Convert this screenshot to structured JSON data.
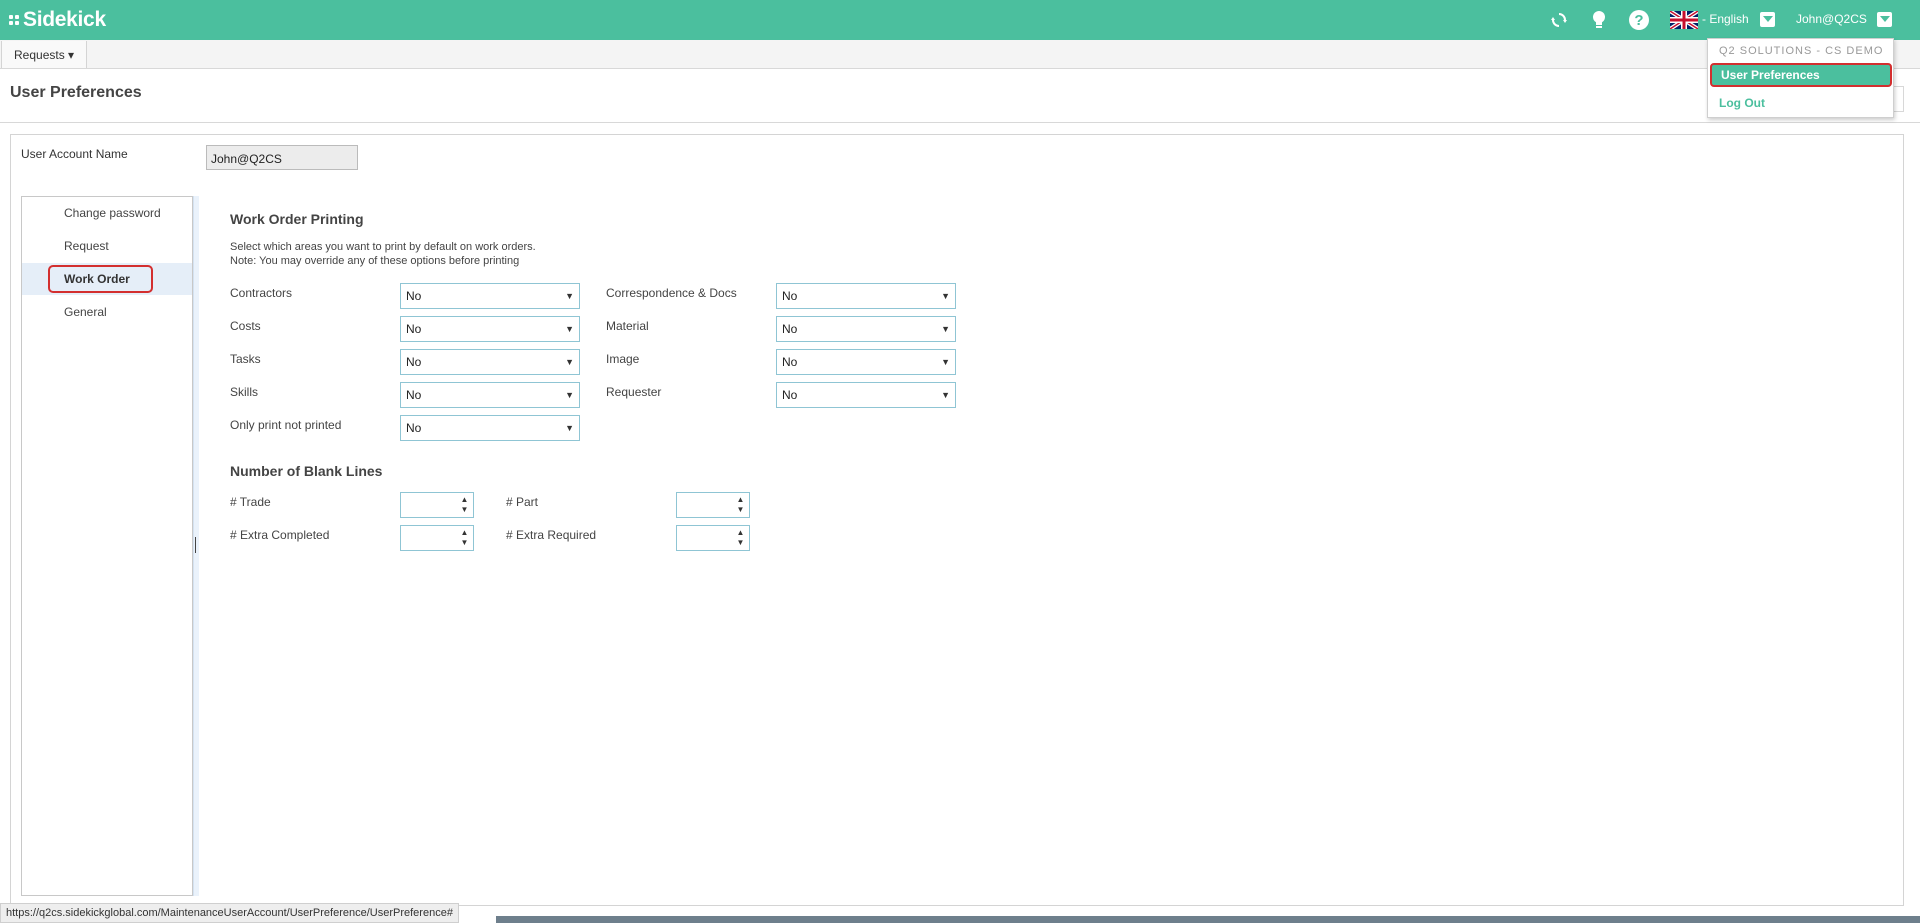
{
  "app": {
    "name": "Sidekick"
  },
  "topbar": {
    "language_label": "- English",
    "user_label": "John@Q2CS"
  },
  "subnav": {
    "requests_label": "Requests ▾"
  },
  "page": {
    "title": "User Preferences"
  },
  "account": {
    "label": "User Account Name",
    "value": "John@Q2CS"
  },
  "sidenav": {
    "items": [
      {
        "label": "Change password"
      },
      {
        "label": "Request"
      },
      {
        "label": "Work Order"
      },
      {
        "label": "General"
      }
    ],
    "active_index": 2
  },
  "printing": {
    "heading": "Work Order Printing",
    "desc_line1": "Select which areas you want to print by default on work orders.",
    "desc_line2": "Note: You may override any of these options before printing",
    "fields": [
      {
        "label": "Contractors",
        "value": "No"
      },
      {
        "label": "Correspondence & Docs",
        "value": "No"
      },
      {
        "label": "Costs",
        "value": "No"
      },
      {
        "label": "Material",
        "value": "No"
      },
      {
        "label": "Tasks",
        "value": "No"
      },
      {
        "label": "Image",
        "value": "No"
      },
      {
        "label": "Skills",
        "value": "No"
      },
      {
        "label": "Requester",
        "value": "No"
      },
      {
        "label": "Only print not printed",
        "value": "No"
      }
    ]
  },
  "blank_lines": {
    "heading": "Number of Blank Lines",
    "fields": [
      {
        "label": "# Trade"
      },
      {
        "label": "# Part"
      },
      {
        "label": "# Extra Completed"
      },
      {
        "label": "# Extra Required"
      }
    ]
  },
  "user_menu": {
    "header": "Q2 SOLUTIONS - CS DEMO",
    "items": [
      {
        "label": "User Preferences"
      },
      {
        "label": "Log Out"
      }
    ]
  },
  "statusbar": {
    "url": "https://q2cs.sidekickglobal.com/MaintenanceUserAccount/UserPreference/UserPreference#"
  },
  "colors": {
    "brand": "#4bbf9e",
    "highlight_border": "#d32f2f",
    "active_nav_bg": "#e5eef8"
  },
  "icons": [
    "refresh-icon",
    "lightbulb-icon",
    "help-icon",
    "uk-flag-icon",
    "chevron-down-icon"
  ]
}
